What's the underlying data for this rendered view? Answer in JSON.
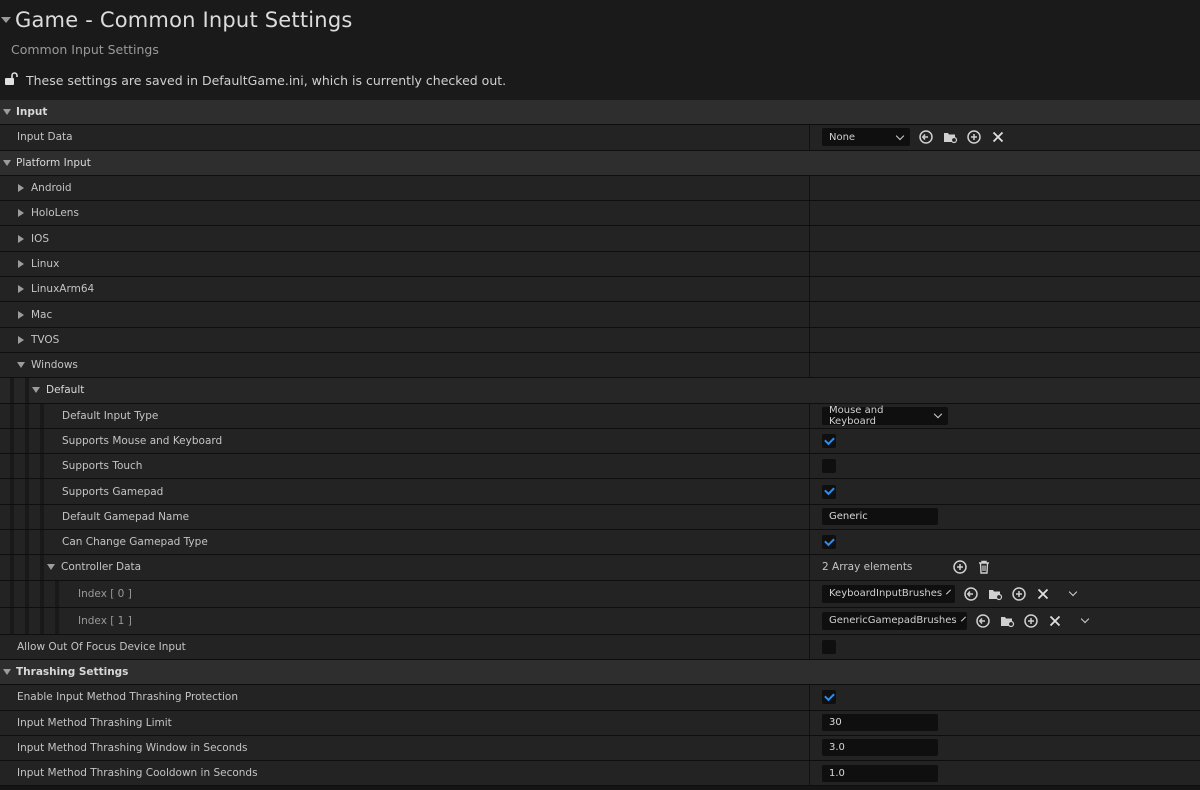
{
  "header": {
    "title": "Game - Common Input Settings",
    "subtitle": "Common Input Settings",
    "notice": "These settings are saved in DefaultGame.ini, which is currently checked out."
  },
  "sections": {
    "input": "Input",
    "platform_input": "Platform Input",
    "thrashing": "Thrashing Settings"
  },
  "input_data": {
    "label": "Input Data",
    "value": "None"
  },
  "platforms": {
    "android": "Android",
    "hololens": "HoloLens",
    "ios": "IOS",
    "linux": "Linux",
    "linuxarm64": "LinuxArm64",
    "mac": "Mac",
    "tvos": "TVOS",
    "windows": "Windows"
  },
  "windows": {
    "default_label": "Default",
    "default_input_type": {
      "label": "Default Input Type",
      "value": "Mouse and Keyboard"
    },
    "supports_mouse_keyboard": {
      "label": "Supports Mouse and Keyboard",
      "checked": true
    },
    "supports_touch": {
      "label": "Supports Touch",
      "checked": false
    },
    "supports_gamepad": {
      "label": "Supports Gamepad",
      "checked": true
    },
    "default_gamepad_name": {
      "label": "Default Gamepad Name",
      "value": "Generic"
    },
    "can_change_gamepad_type": {
      "label": "Can Change Gamepad Type",
      "checked": true
    },
    "controller_data": {
      "label": "Controller Data",
      "count": "2 Array elements",
      "items": [
        {
          "label": "Index [ 0 ]",
          "value": "KeyboardInputBrushes"
        },
        {
          "label": "Index [ 1 ]",
          "value": "GenericGamepadBrushes"
        }
      ]
    }
  },
  "allow_out_of_focus": {
    "label": "Allow Out Of Focus Device Input",
    "checked": false
  },
  "thrashing": {
    "enable": {
      "label": "Enable Input Method Thrashing Protection",
      "checked": true
    },
    "limit": {
      "label": "Input Method Thrashing Limit",
      "value": "30"
    },
    "window": {
      "label": "Input Method Thrashing Window in Seconds",
      "value": "3.0"
    },
    "cooldown": {
      "label": "Input Method Thrashing Cooldown in Seconds",
      "value": "1.0"
    }
  },
  "colors": {
    "accent": "#2c8ef0",
    "background": "#151515",
    "row": "#232323",
    "section": "#2e2e2e"
  }
}
